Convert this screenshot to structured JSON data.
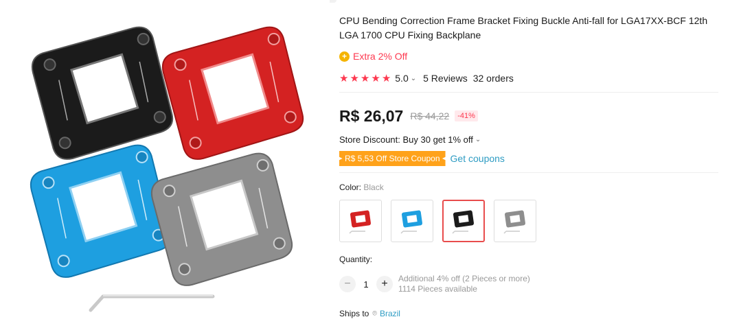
{
  "product": {
    "title": "CPU Bending Correction Frame Bracket Fixing Buckle Anti-fall for LGA17XX-BCF 12th LGA 1700 CPU Fixing Backplane",
    "extra_off": "Extra 2% Off",
    "rating": "5.0",
    "reviews": "5 Reviews",
    "orders": "32 orders",
    "price": "R$ 26,07",
    "old_price": "R$ 44,22",
    "discount": "-41%",
    "store_discount": "Store Discount: Buy 30 get 1% off",
    "coupon": "R$ 5,53 Off Store Coupon",
    "get_coupons": "Get coupons"
  },
  "color": {
    "label": "Color: ",
    "selected": "Black",
    "options": [
      "red",
      "blue",
      "black",
      "gray"
    ],
    "active_index": 2
  },
  "quantity": {
    "label": "Quantity:",
    "value": "1",
    "minus": "−",
    "plus": "+",
    "additional": "Additional 4% off (2 Pieces or more)",
    "available": "1114 Pieces available"
  },
  "shipping": {
    "label": "Ships to",
    "country": "Brazil"
  },
  "icons": {
    "coin": "coin-icon",
    "star": "star-icon",
    "chevron": "chevron-down-icon",
    "pin": "location-pin-icon"
  },
  "colors": {
    "accent_red": "#fd384f",
    "coupon_orange": "#ffa21a",
    "link_blue": "#2e9cc3",
    "star": "#fd384f"
  }
}
